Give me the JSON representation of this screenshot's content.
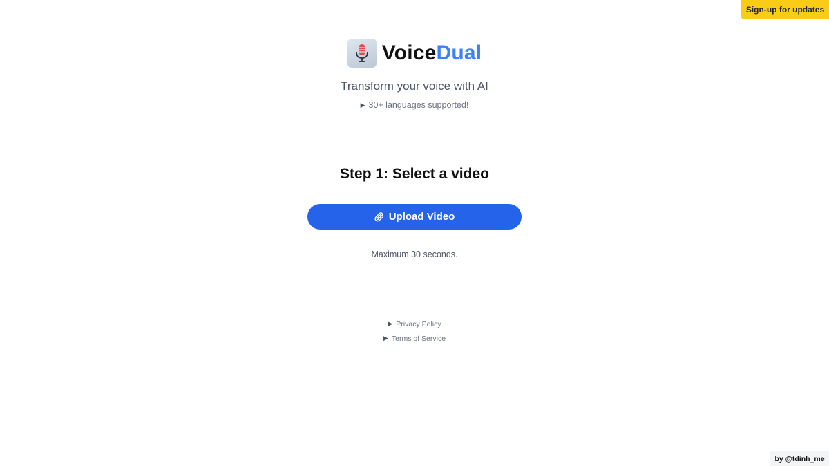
{
  "header": {
    "signup_label": "Sign-up for updates"
  },
  "brand": {
    "name_part1": "Voice",
    "name_part2": "Dual",
    "logo_icon": "microphone-icon",
    "accent_color": "#3b82f6"
  },
  "hero": {
    "tagline": "Transform your voice with AI",
    "languages_label": "30+ languages supported!"
  },
  "step": {
    "title": "Step 1: Select a video",
    "upload_label": "Upload Video",
    "upload_icon": "paperclip-icon",
    "max_note": "Maximum 30 seconds."
  },
  "footer": {
    "privacy_label": "Privacy Policy",
    "terms_label": "Terms of Service",
    "credit": "by @tdinh_me"
  },
  "colors": {
    "primary_button": "#2563eb",
    "signup_button": "#facc15"
  }
}
